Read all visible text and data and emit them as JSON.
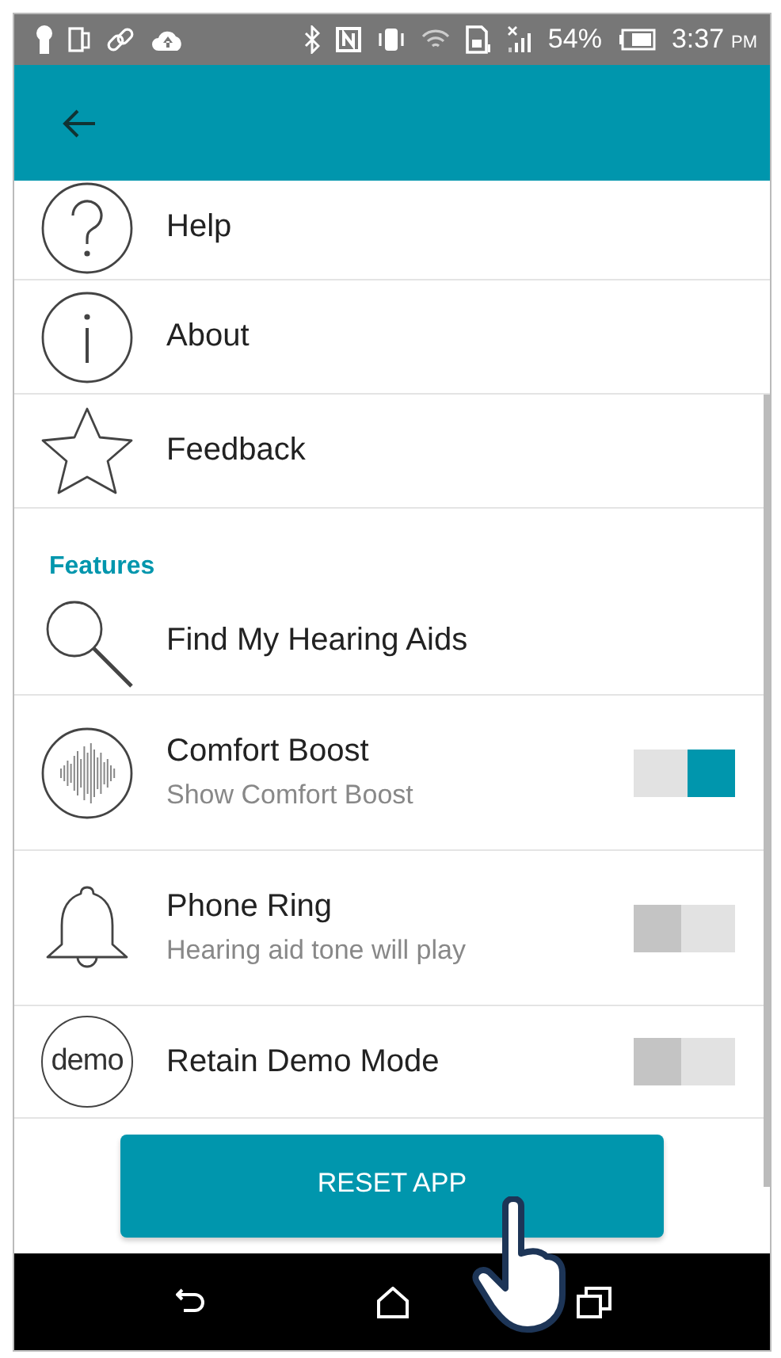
{
  "status_bar": {
    "battery": "54%",
    "time": "3:37",
    "meridiem": "PM"
  },
  "items": [
    {
      "kind": "help",
      "label": "Help"
    },
    {
      "kind": "info",
      "label": "About"
    },
    {
      "kind": "star",
      "label": "Feedback"
    },
    {
      "kind": "header",
      "label": "Features"
    },
    {
      "kind": "search",
      "label": "Find My Hearing Aids"
    },
    {
      "kind": "wave",
      "label": "Comfort Boost",
      "subtitle": "Show Comfort Boost",
      "on": true
    },
    {
      "kind": "bell",
      "label": "Phone Ring",
      "subtitle": "Hearing aid tone will play",
      "on": false
    },
    {
      "kind": "demo",
      "label": "Retain Demo Mode",
      "icon_text": "demo",
      "on": false
    }
  ],
  "reset_button": "RESET APP"
}
